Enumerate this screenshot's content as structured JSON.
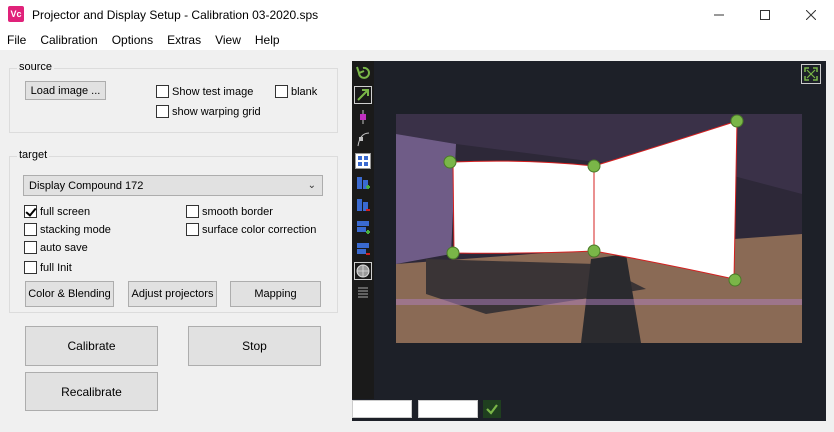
{
  "window": {
    "title": "Projector and Display Setup - Calibration 03-2020.sps",
    "icon_text": "Vc"
  },
  "menu": [
    "File",
    "Calibration",
    "Options",
    "Extras",
    "View",
    "Help"
  ],
  "source": {
    "legend": "source",
    "load_image": "Load image ...",
    "show_test_image": {
      "label": "Show test image",
      "checked": false
    },
    "blank": {
      "label": "blank",
      "checked": false
    },
    "show_warping_grid": {
      "label": "show warping grid",
      "checked": false
    }
  },
  "target": {
    "legend": "target",
    "display_select": "Display Compound 172",
    "full_screen": {
      "label": "full screen",
      "checked": true
    },
    "smooth_border": {
      "label": "smooth border",
      "checked": false
    },
    "stacking_mode": {
      "label": "stacking mode",
      "checked": false
    },
    "surface_color_correction": {
      "label": "surface color correction",
      "checked": false
    },
    "auto_save": {
      "label": "auto save",
      "checked": false
    },
    "full_init": {
      "label": "full Init",
      "checked": false
    },
    "color_blending": "Color & Blending",
    "adjust_projectors": "Adjust projectors",
    "mapping": "Mapping"
  },
  "actions": {
    "calibrate": "Calibrate",
    "stop": "Stop",
    "recalibrate": "Recalibrate"
  },
  "colors": {
    "accent_green": "#7ab648",
    "warp_line": "#d42020",
    "panel_bg": "#1d2028"
  },
  "icons": [
    "undo-icon",
    "move-arrow-icon",
    "vertical-handle-icon",
    "curve-icon",
    "grid-points-icon",
    "add-column-icon",
    "remove-column-icon",
    "add-row-icon",
    "remove-row-icon",
    "sphere-icon",
    "lines-icon",
    "fit-view-icon",
    "checkmark-icon"
  ]
}
